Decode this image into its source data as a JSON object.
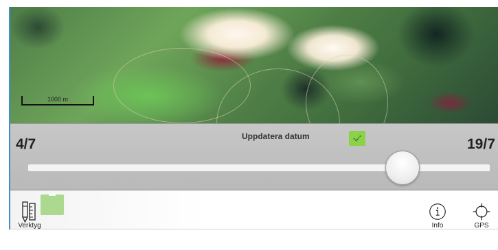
{
  "map": {
    "scale_label": "1000 m"
  },
  "date_panel": {
    "start_label": "4/7",
    "end_label": "19/7",
    "update_label": "Uppdatera datum",
    "update_checked": true,
    "slider_position_fraction": 0.85
  },
  "toolbar": {
    "verktyg": {
      "label": "Verktyg",
      "icon": "ruler-pencil-icon"
    },
    "info": {
      "label": "Info",
      "icon": "info-icon"
    },
    "gps": {
      "label": "GPS",
      "icon": "crosshair-icon"
    }
  },
  "colors": {
    "accent_green": "#8bd14a",
    "panel_gray": "#c0c0c0",
    "left_border_blue": "#3d8fd6"
  }
}
